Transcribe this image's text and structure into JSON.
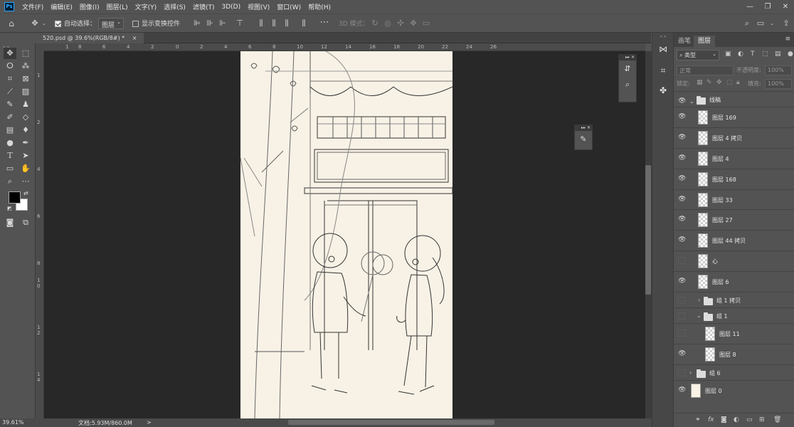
{
  "app": {
    "logo": "Ps"
  },
  "menu": [
    "文件(F)",
    "编辑(E)",
    "图像(I)",
    "图层(L)",
    "文字(Y)",
    "选择(S)",
    "滤镜(T)",
    "3D(D)",
    "视图(V)",
    "窗口(W)",
    "帮助(H)"
  ],
  "window_controls": {
    "minimize": "—",
    "restore": "❐",
    "close": "✕"
  },
  "options": {
    "auto_select_label": "自动选择：",
    "auto_select_value": "图层",
    "show_transform_label": "显示变换控件",
    "mode_3d_label": "3D 模式："
  },
  "document": {
    "tab_title": "520.psd @ 39.6%(RGB/8#) *",
    "tab_close": "×"
  },
  "rulers": {
    "top": [
      "1",
      "8",
      "6",
      "4",
      "2",
      "0",
      "2",
      "4",
      "6",
      "8",
      "10",
      "12",
      "14",
      "16",
      "18",
      "20",
      "22",
      "24",
      "26"
    ],
    "left": [
      "1",
      "2",
      "4",
      "6",
      "8",
      "1",
      "0",
      "1",
      "2",
      "1",
      "4"
    ]
  },
  "status": {
    "zoom": "39.61%",
    "doc_info": "文档:5.93M/860.0M",
    "arrow": ">"
  },
  "layers_panel": {
    "tabs": [
      "画笔",
      "图层"
    ],
    "filter_label": "类型",
    "blend_mode": "正常",
    "opacity_label": "不透明度:",
    "opacity_value": "100%",
    "lock_label": "锁定:",
    "fill_label": "填充:",
    "fill_value": "100%",
    "layers": [
      {
        "name": "线稿",
        "type": "group-open",
        "visible": true,
        "indent": 0
      },
      {
        "name": "图层 169",
        "type": "layer",
        "visible": true,
        "indent": 1
      },
      {
        "name": "图层 4 拷贝",
        "type": "layer",
        "visible": true,
        "indent": 1
      },
      {
        "name": "图层 4",
        "type": "layer",
        "visible": true,
        "indent": 1
      },
      {
        "name": "图层 168",
        "type": "layer",
        "visible": true,
        "indent": 1
      },
      {
        "name": "图层 33",
        "type": "layer",
        "visible": true,
        "indent": 1
      },
      {
        "name": "图层 27",
        "type": "layer",
        "visible": true,
        "indent": 1
      },
      {
        "name": "图层 44 拷贝",
        "type": "layer",
        "visible": true,
        "indent": 1
      },
      {
        "name": "心",
        "type": "layer",
        "visible": false,
        "indent": 1
      },
      {
        "name": "图层 6",
        "type": "layer",
        "visible": true,
        "indent": 1
      },
      {
        "name": "组 1 拷贝",
        "type": "group-closed",
        "visible": false,
        "indent": 1
      },
      {
        "name": "组 1",
        "type": "group-open",
        "visible": false,
        "indent": 1
      },
      {
        "name": "图层 11",
        "type": "layer",
        "visible": false,
        "indent": 2
      },
      {
        "name": "图层 8",
        "type": "layer",
        "visible": true,
        "indent": 2
      },
      {
        "name": "组 6",
        "type": "group-closed",
        "visible": false,
        "indent": 0
      },
      {
        "name": "图层 0",
        "type": "solid",
        "visible": true,
        "indent": 0
      }
    ]
  }
}
